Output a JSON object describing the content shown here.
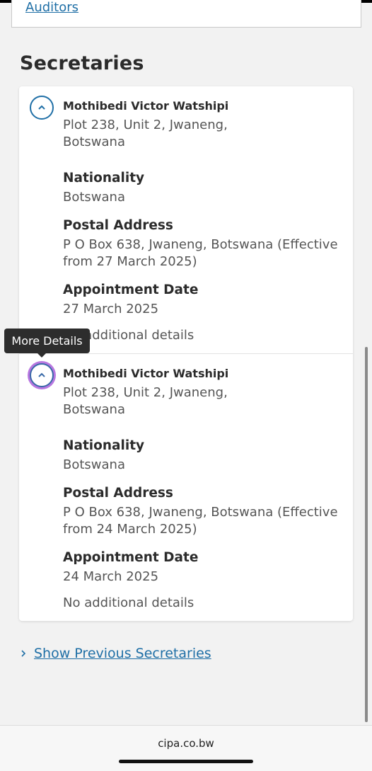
{
  "previous_section": {
    "link_label": "Auditors"
  },
  "section_title": "Secretaries",
  "secretaries": [
    {
      "name": "Mothibedi Victor Watshipi",
      "address": "Plot 238, Unit 2, Jwaneng, Botswana",
      "nationality_label": "Nationality",
      "nationality": "Botswana",
      "postal_label": "Postal Address",
      "postal_address": "P O Box 638, Jwaneng, Botswana (Effective from 27 March 2025)",
      "appointment_label": "Appointment Date",
      "appointment_date": "27 March 2025",
      "additional": "No additional details"
    },
    {
      "name": "Mothibedi Victor Watshipi",
      "address": "Plot 238, Unit 2, Jwaneng, Botswana",
      "nationality_label": "Nationality",
      "nationality": "Botswana",
      "postal_label": "Postal Address",
      "postal_address": "P O Box 638, Jwaneng, Botswana (Effective from 24 March 2025)",
      "appointment_label": "Appointment Date",
      "appointment_date": "24 March 2025",
      "additional": "No additional details"
    }
  ],
  "tooltip": "More Details",
  "show_previous_label": "Show Previous Secretaries",
  "browser": {
    "domain": "cipa.co.bw"
  },
  "icons": {
    "toggle": "chevron-up-icon",
    "show_previous": "chevron-right-icon"
  },
  "colors": {
    "link": "#1f6fa6",
    "focus_ring": "#b877e0",
    "tooltip_bg": "#2d2d2d"
  }
}
